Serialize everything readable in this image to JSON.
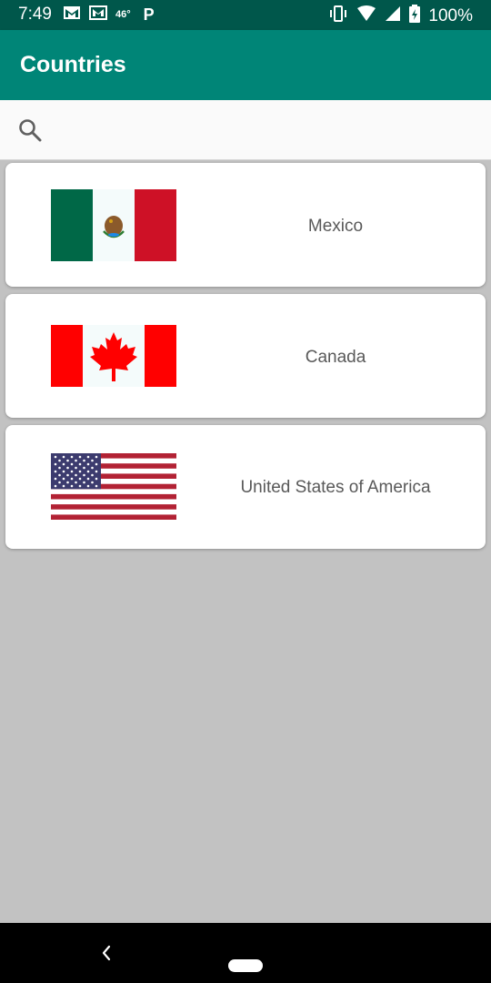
{
  "status_bar": {
    "time": "7:49",
    "temperature": "46°",
    "p_badge": "P",
    "battery": "100%",
    "left_icons": [
      "gmail-icon",
      "gmail-outline-icon",
      "parking-icon"
    ],
    "right_icons": [
      "vibrate-icon",
      "wifi-icon",
      "signal-icon",
      "battery-icon"
    ]
  },
  "app_bar": {
    "title": "Countries",
    "color": "#008577",
    "status_color": "#00574b"
  },
  "search": {
    "icon": "search-icon",
    "placeholder": ""
  },
  "countries": [
    {
      "name": "Mexico",
      "flag": "mexico-flag-icon"
    },
    {
      "name": "Canada",
      "flag": "canada-flag-icon"
    },
    {
      "name": "United States of America",
      "flag": "usa-flag-icon"
    }
  ],
  "nav_bar": {
    "back": "back-icon",
    "home": "home-pill-icon"
  }
}
